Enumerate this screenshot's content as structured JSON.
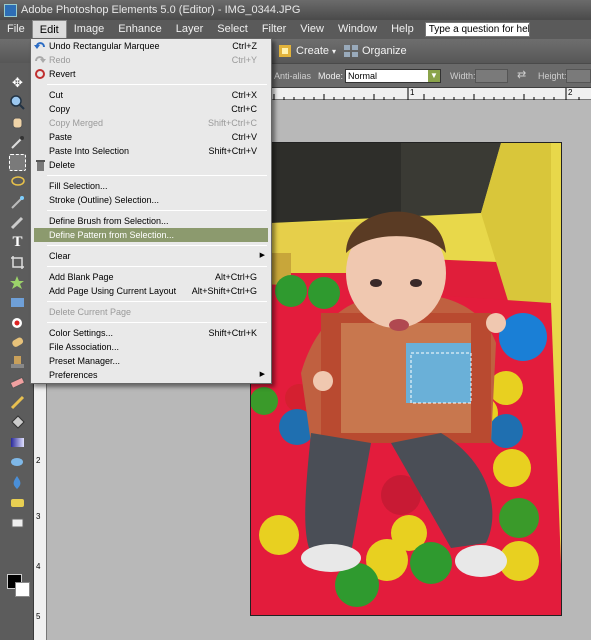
{
  "window": {
    "title": "Adobe Photoshop Elements 5.0 (Editor) - IMG_0344.JPG"
  },
  "menubar": {
    "items": [
      "File",
      "Edit",
      "Image",
      "Enhance",
      "Layer",
      "Select",
      "Filter",
      "View",
      "Window",
      "Help"
    ],
    "active": "Edit",
    "help_placeholder": "Type a question for help"
  },
  "shortcuts": {
    "create": "Create",
    "organize": "Organize"
  },
  "options": {
    "antialias": "Anti-alias",
    "mode_label": "Mode:",
    "mode_value": "Normal",
    "width_label": "Width:",
    "height_label": "Height:"
  },
  "ruler": {
    "top": [
      "1",
      "2"
    ],
    "left": [
      "2",
      "3",
      "4",
      "5"
    ]
  },
  "edit_menu": {
    "items": [
      {
        "label": "Undo Rectangular Marquee",
        "shortcut": "Ctrl+Z",
        "icon": "undo-icon"
      },
      {
        "label": "Redo",
        "shortcut": "Ctrl+Y",
        "disabled": true,
        "icon": "redo-icon"
      },
      {
        "label": "Revert",
        "shortcut": "",
        "icon": "revert-icon"
      },
      {
        "label": "Cut",
        "shortcut": "Ctrl+X"
      },
      {
        "label": "Copy",
        "shortcut": "Ctrl+C"
      },
      {
        "label": "Copy Merged",
        "shortcut": "Shift+Ctrl+C",
        "disabled": true
      },
      {
        "label": "Paste",
        "shortcut": "Ctrl+V"
      },
      {
        "label": "Paste Into Selection",
        "shortcut": "Shift+Ctrl+V"
      },
      {
        "label": "Delete",
        "shortcut": "",
        "icon": "trash-icon"
      },
      {
        "label": "Fill Selection...",
        "shortcut": ""
      },
      {
        "label": "Stroke (Outline) Selection...",
        "shortcut": ""
      },
      {
        "label": "Define Brush from Selection...",
        "shortcut": ""
      },
      {
        "label": "Define Pattern from Selection...",
        "shortcut": "",
        "highlighted": true
      },
      {
        "label": "Clear",
        "shortcut": "",
        "submenu": true
      },
      {
        "label": "Add Blank Page",
        "shortcut": "Alt+Ctrl+G"
      },
      {
        "label": "Add Page Using Current Layout",
        "shortcut": "Alt+Shift+Ctrl+G"
      },
      {
        "label": "Delete Current Page",
        "shortcut": "",
        "disabled": true
      },
      {
        "label": "Color Settings...",
        "shortcut": "Shift+Ctrl+K"
      },
      {
        "label": "File Association...",
        "shortcut": ""
      },
      {
        "label": "Preset Manager...",
        "shortcut": ""
      },
      {
        "label": "Preferences",
        "shortcut": "",
        "submenu": true
      }
    ]
  },
  "colors": {
    "menu_highlight": "#8c9a6e",
    "menubar": "#5a5a5a",
    "canvas": "#b8b8b8"
  }
}
